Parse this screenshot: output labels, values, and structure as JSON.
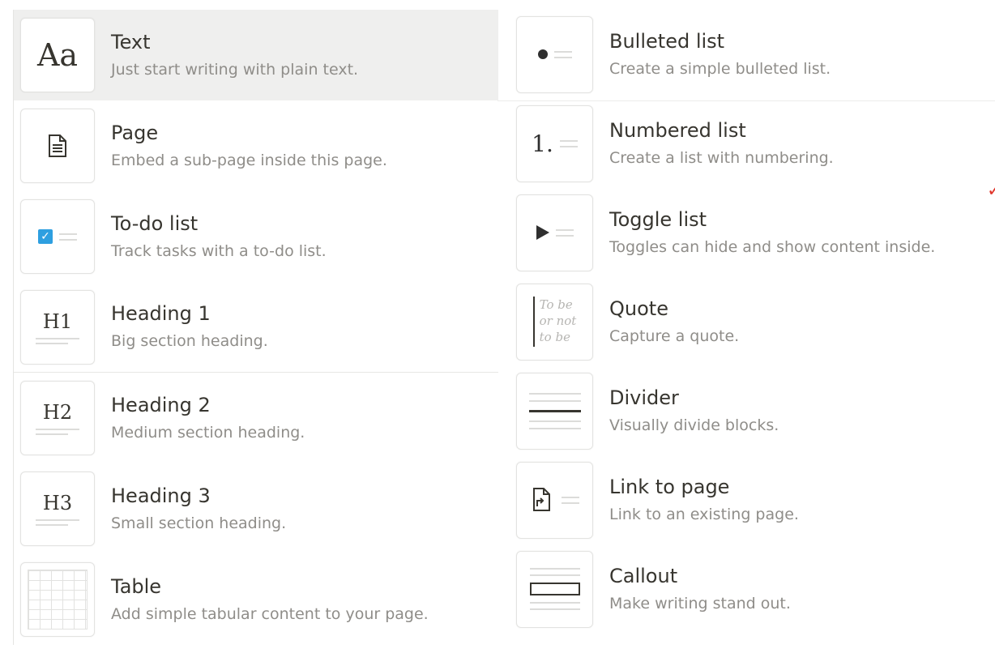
{
  "left_items": [
    {
      "title": "Text",
      "description": "Just start writing with plain text.",
      "icon": "text-aa-icon",
      "icon_label": "Aa"
    },
    {
      "title": "Page",
      "description": "Embed a sub-page inside this page.",
      "icon": "page-icon"
    },
    {
      "title": "To-do list",
      "description": "Track tasks with a to-do list.",
      "icon": "checkbox-icon"
    },
    {
      "title": "Heading 1",
      "description": "Big section heading.",
      "icon": "heading-1-icon",
      "icon_label": "H1"
    },
    {
      "title": "Heading 2",
      "description": "Medium section heading.",
      "icon": "heading-2-icon",
      "icon_label": "H2"
    },
    {
      "title": "Heading 3",
      "description": "Small section heading.",
      "icon": "heading-3-icon",
      "icon_label": "H3"
    },
    {
      "title": "Table",
      "description": "Add simple tabular content to your page.",
      "icon": "table-icon"
    }
  ],
  "right_items": [
    {
      "title": "Bulleted list",
      "description": "Create a simple bulleted list.",
      "icon": "bullet-list-icon"
    },
    {
      "title": "Numbered list",
      "description": "Create a list with numbering.",
      "icon": "numbered-list-icon",
      "icon_label": "1."
    },
    {
      "title": "Toggle list",
      "description": "Toggles can hide and show content inside.",
      "icon": "toggle-list-icon"
    },
    {
      "title": "Quote",
      "description": "Capture a quote.",
      "icon": "quote-icon",
      "icon_lines": [
        "To be",
        "or not",
        "to be"
      ]
    },
    {
      "title": "Divider",
      "description": "Visually divide blocks.",
      "icon": "divider-icon"
    },
    {
      "title": "Link to page",
      "description": "Link to an existing page.",
      "icon": "link-to-page-icon"
    },
    {
      "title": "Callout",
      "description": "Make writing stand out.",
      "icon": "callout-icon"
    }
  ],
  "selected_item": "Text",
  "colors": {
    "selected_bg": "#efefee",
    "checkbox_blue": "#2e9fe0",
    "text_primary": "#37352f",
    "text_secondary": "#8f8d89",
    "annotation_red": "#e0362c"
  }
}
